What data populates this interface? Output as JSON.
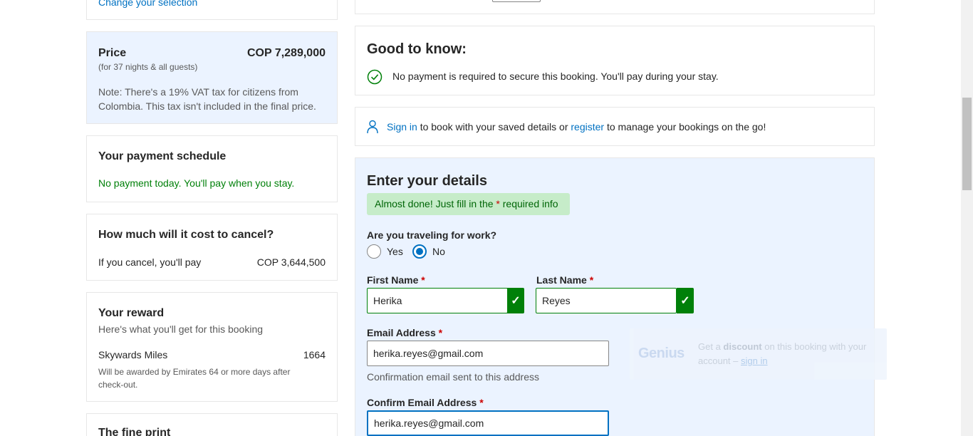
{
  "selection": {
    "change_link": "Change your selection"
  },
  "price": {
    "title": "Price",
    "amount": "COP 7,289,000",
    "sub": "(for 37 nights & all guests)",
    "note": "Note: There's a 19% VAT tax for citizens from Colombia. This tax isn't included in the final price."
  },
  "payment_schedule": {
    "title": "Your payment schedule",
    "text": "No payment today. You'll pay when you stay."
  },
  "cancel": {
    "title": "How much will it cost to cancel?",
    "label": "If you cancel, you'll pay",
    "amount": "COP 3,644,500"
  },
  "reward": {
    "title": "Your reward",
    "sub": "Here's what you'll get for this booking",
    "program": "Skywards Miles",
    "miles": "1664",
    "note": "Will be awarded by Emirates 64 or more days after check-out."
  },
  "fine_print": {
    "title": "The fine print"
  },
  "good_to_know": {
    "title": "Good to know:",
    "item": "No payment is required to secure this booking. You'll pay during your stay."
  },
  "signin_bar": {
    "signin": "Sign in",
    "text1": "to book with your saved details or",
    "register": "register",
    "text2": "to manage your bookings on the go!"
  },
  "details": {
    "title": "Enter your details",
    "almost_prefix": "Almost done! Just fill in the",
    "required_star": "*",
    "almost_suffix": "required info",
    "work_question": "Are you traveling for work?",
    "yes": "Yes",
    "no": "No",
    "first_name_label": "First Name",
    "first_name_value": "Herika",
    "last_name_label": "Last Name",
    "last_name_value": "Reyes",
    "email_label": "Email Address",
    "email_value": "herika.reyes@gmail.com",
    "email_helper": "Confirmation email sent to this address",
    "confirm_label": "Confirm Email Address",
    "confirm_value": "herika.reyes@gmail.com",
    "check_mark": "✓"
  },
  "genius": {
    "logo": "Genius",
    "text_pre": "Get a",
    "text_bold": "discount",
    "text_post": "on this booking with your account –",
    "link": "sign in"
  },
  "colors": {
    "accent": "#0071c2",
    "success": "#008009",
    "required": "#cc0000"
  }
}
